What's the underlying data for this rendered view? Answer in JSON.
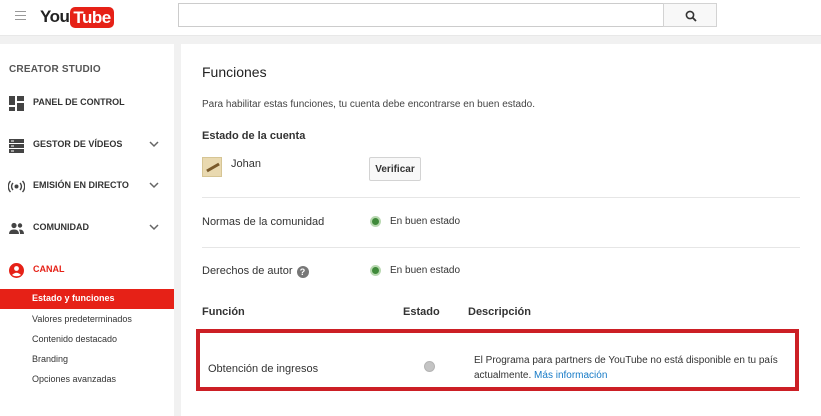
{
  "header": {
    "logo_part1": "You",
    "logo_part2": "Tube",
    "search_placeholder": "",
    "brand_color": "#e62117"
  },
  "sidebar": {
    "title": "CREATOR STUDIO",
    "items": [
      {
        "label": "PANEL DE CONTROL",
        "icon": "dashboard-icon"
      },
      {
        "label": "GESTOR DE VÍDEOS",
        "icon": "video-manager-icon",
        "expandable": true
      },
      {
        "label": "EMISIÓN EN DIRECTO",
        "icon": "live-broadcast-icon",
        "expandable": true
      },
      {
        "label": "COMUNIDAD",
        "icon": "community-icon",
        "expandable": true
      },
      {
        "label": "CANAL",
        "icon": "channel-icon",
        "active": true
      }
    ],
    "sub_items": [
      {
        "label": "Estado y funciones",
        "selected": true
      },
      {
        "label": "Valores predeterminados"
      },
      {
        "label": "Contenido destacado"
      },
      {
        "label": "Branding"
      },
      {
        "label": "Opciones avanzadas"
      }
    ]
  },
  "main": {
    "title": "Funciones",
    "intro": "Para habilitar estas funciones, tu cuenta debe encontrarse en buen estado.",
    "account_section": "Estado de la cuenta",
    "user_name": "Johan",
    "verify_label": "Verificar",
    "rows": [
      {
        "label": "Normas de la comunidad",
        "status": "En buen estado"
      },
      {
        "label": "Derechos de autor",
        "status": "En buen estado",
        "help": "?"
      }
    ],
    "columns": {
      "feature": "Función",
      "status": "Estado",
      "description": "Descripción"
    },
    "feature": {
      "name": "Obtención de ingresos",
      "description": "El Programa para partners de YouTube no está disponible en tu país actualmente.",
      "link": "Más información"
    },
    "status_colors": {
      "good": "#3f8a3a",
      "inactive": "#c4c4c4",
      "highlight": "#cc1f25"
    }
  }
}
